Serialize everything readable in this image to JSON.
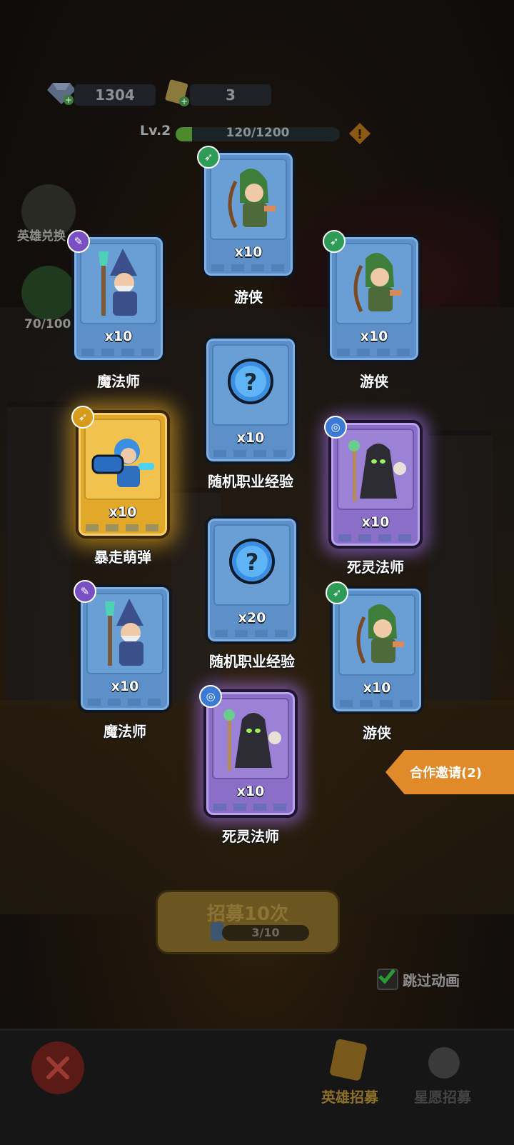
{
  "currency": {
    "gems": "1304",
    "tickets": "3"
  },
  "level": {
    "label": "Lv.2",
    "progress_text": "120/1200",
    "progress_fraction": 0.1
  },
  "side": {
    "hero_exchange_label": "英雄兑换",
    "star_progress": "70/100"
  },
  "cards": [
    {
      "name": "游侠",
      "qty": "x10",
      "rarity": "blue",
      "class_icon": "bow-icon",
      "art": "ranger"
    },
    {
      "name": "魔法师",
      "qty": "x10",
      "rarity": "blue",
      "class_icon": "wand-icon",
      "art": "wizard"
    },
    {
      "name": "游侠",
      "qty": "x10",
      "rarity": "blue",
      "class_icon": "bow-icon",
      "art": "ranger"
    },
    {
      "name": "随机职业经验",
      "qty": "x10",
      "rarity": "blue",
      "class_icon": "",
      "art": "exp-orb"
    },
    {
      "name": "暴走萌弹",
      "qty": "x10",
      "rarity": "gold",
      "class_icon": "bow-icon",
      "art": "cannon-hero"
    },
    {
      "name": "死灵法师",
      "qty": "x10",
      "rarity": "purple",
      "class_icon": "spiral-icon",
      "art": "necromancer"
    },
    {
      "name": "随机职业经验",
      "qty": "x20",
      "rarity": "blue",
      "class_icon": "",
      "art": "exp-orb"
    },
    {
      "name": "魔法师",
      "qty": "x10",
      "rarity": "blue",
      "class_icon": "wand-icon",
      "art": "wizard"
    },
    {
      "name": "游侠",
      "qty": "x10",
      "rarity": "blue",
      "class_icon": "bow-icon",
      "art": "ranger"
    },
    {
      "name": "死灵法师",
      "qty": "x10",
      "rarity": "purple",
      "class_icon": "spiral-icon",
      "art": "necromancer"
    }
  ],
  "coop_invite": {
    "label": "合作邀请(2)"
  },
  "recruit": {
    "title": "招募10次",
    "progress": "3/10"
  },
  "skip_animation": {
    "label": "跳过动画",
    "checked": true
  },
  "tabs": [
    {
      "label": "英雄招募",
      "active": true
    },
    {
      "label": "星愿招募",
      "active": false
    }
  ],
  "colors": {
    "blue_card": "#5d90c9",
    "gold_card": "#e2a82a",
    "purple_card": "#8a6ec8",
    "coop": "#e08a2a"
  }
}
